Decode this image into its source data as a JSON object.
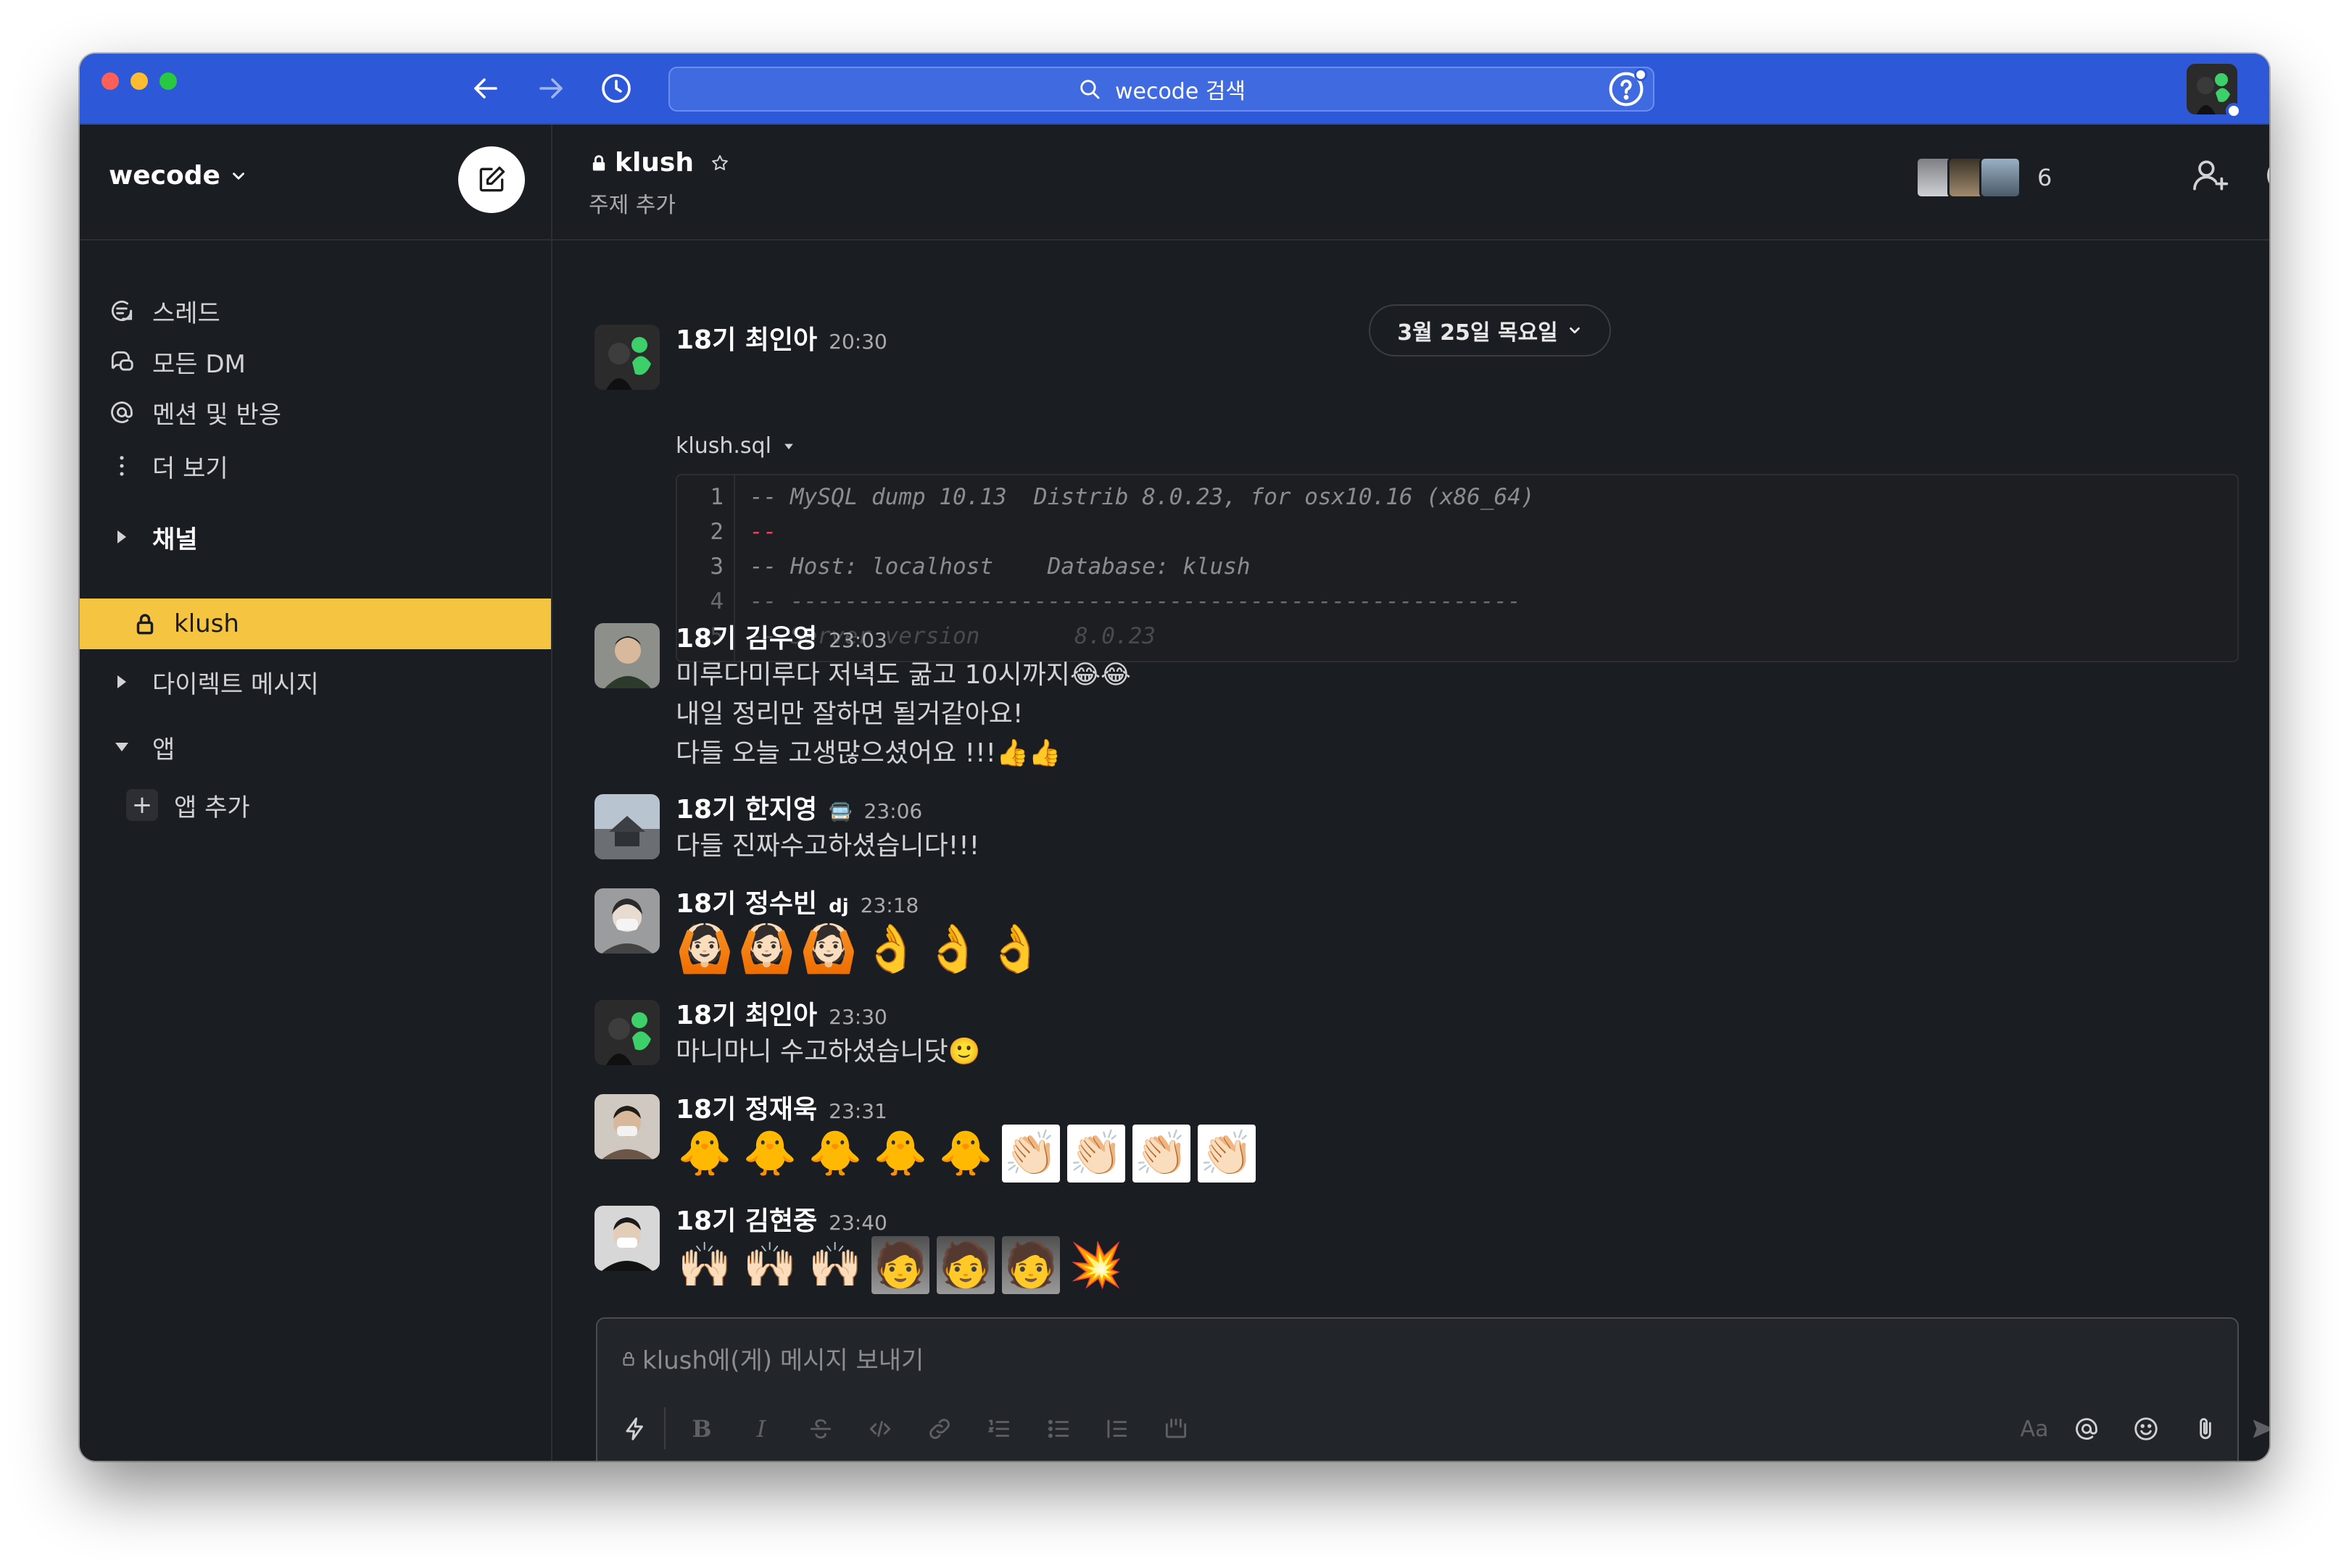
{
  "topbar": {
    "search_text": "wecode 검색"
  },
  "sidebar": {
    "workspace_name": "wecode",
    "nav": [
      {
        "label": "스레드",
        "icon": "threads-icon"
      },
      {
        "label": "모든 DM",
        "icon": "dm-icon"
      },
      {
        "label": "멘션 및 반응",
        "icon": "mention-icon"
      },
      {
        "label": "더 보기",
        "icon": "more-vertical-icon"
      }
    ],
    "channels_section": "채널",
    "active_channel": "klush",
    "dm_section": "다이렉트 메시지",
    "apps_section": "앱",
    "add_app": "앱 추가"
  },
  "channel": {
    "name": "klush",
    "topic": "주제 추가",
    "member_count": "6",
    "date_divider": "3월 25일 목요일"
  },
  "messages": [
    {
      "sender": "18기 최인아",
      "time": "20:30",
      "file_name": "klush.sql",
      "code": [
        {
          "n": "1",
          "text": "-- MySQL dump 10.13  Distrib 8.0.23, for osx10.16 (x86_64)"
        },
        {
          "n": "2",
          "text": "--"
        },
        {
          "n": "3",
          "text": "-- Host: localhost    Database: klush"
        },
        {
          "n": "4",
          "text": "-- ------------------------------------------------------"
        },
        {
          "n": "5",
          "text": "-- Server version\t8.0.23"
        }
      ]
    },
    {
      "sender": "18기 김우영",
      "time": "23:03",
      "lines": [
        "미루다미루다 저녁도 굶고 10시까지😂😂",
        "내일 정리만 잘하면 될거같아요!",
        "다들 오늘 고생많으셨어요 !!!👍👍"
      ]
    },
    {
      "sender": "18기 한지영",
      "status_emoji": "🚍",
      "time": "23:06",
      "lines": [
        "다들 진짜수고하셨습니다!!!"
      ]
    },
    {
      "sender": "18기 정수빈",
      "status_emoji": "dj",
      "time": "23:18",
      "emojis": [
        "🙆🏻",
        "🙆🏻",
        "🙆🏻",
        "👌",
        "👌",
        "👌"
      ]
    },
    {
      "sender": "18기 최인아",
      "time": "23:30",
      "lines": [
        "마니마니 수고하셨습니닷🙂"
      ]
    },
    {
      "sender": "18기 정재욱",
      "time": "23:31",
      "emojis": [
        "🐥",
        "🐥",
        "🐥",
        "🐥",
        "🐥"
      ],
      "boxed_emojis": [
        "👏🏻",
        "👏🏻",
        "👏🏻",
        "👏🏻"
      ]
    },
    {
      "sender": "18기 김현중",
      "time": "23:40",
      "emojis": [
        "🙌🏻",
        "🙌🏻",
        "🙌🏻"
      ],
      "photo_emojis": [
        "🧑",
        "🧑",
        "🧑"
      ],
      "burst_emoji": "💥"
    }
  ],
  "composer": {
    "placeholder": "klush에(게) 메시지 보내기",
    "format_label": "Aa"
  },
  "colors": {
    "topbar": "#2d59d8",
    "active_channel_bg": "#f5c542",
    "background": "#1a1d21"
  }
}
